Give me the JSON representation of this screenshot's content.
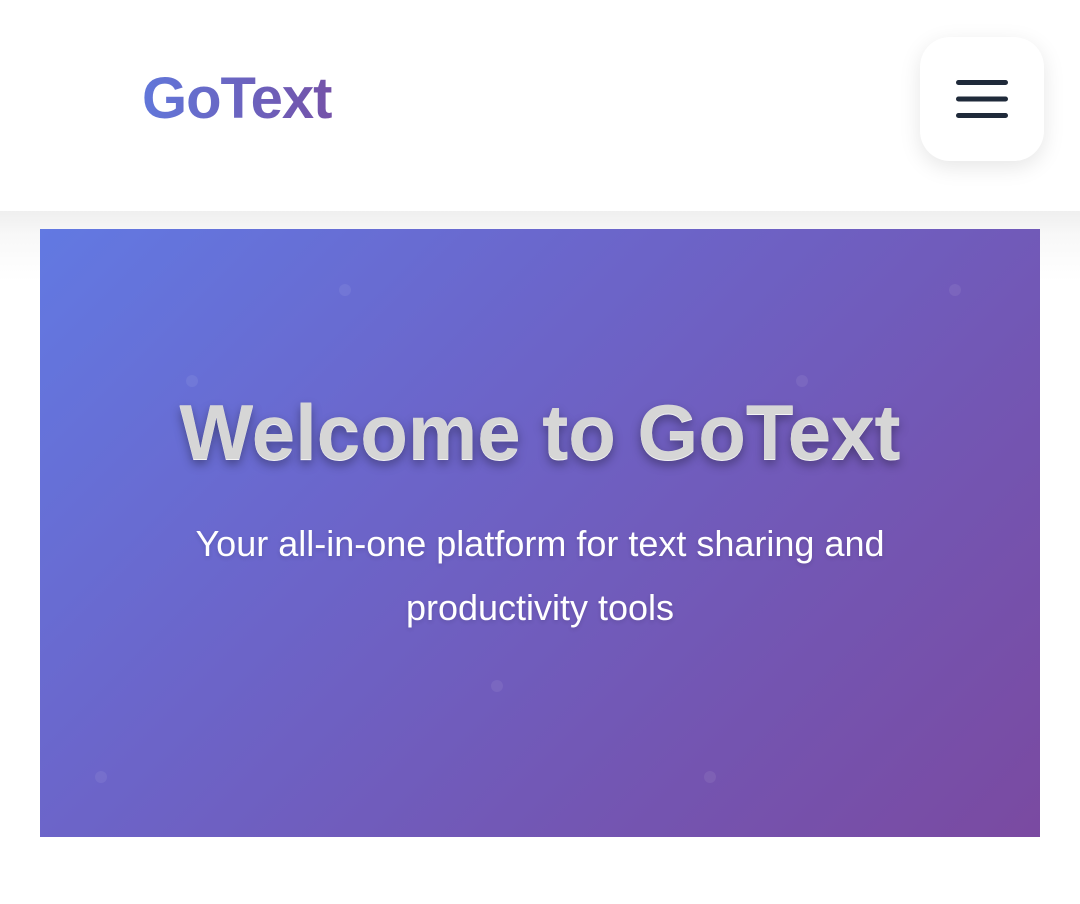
{
  "header": {
    "logo_text": "GoText",
    "menu_icon": "hamburger-menu-icon"
  },
  "hero": {
    "title": "Welcome to GoText",
    "subtitle": "Your all-in-one platform for text sharing and productivity tools"
  },
  "colors": {
    "logo_gradient_start": "#6177da",
    "logo_gradient_end": "#7452a8",
    "hero_gradient_start": "#6279e2",
    "hero_gradient_end": "#7a4aa1",
    "menu_icon": "#1f2a3a"
  }
}
